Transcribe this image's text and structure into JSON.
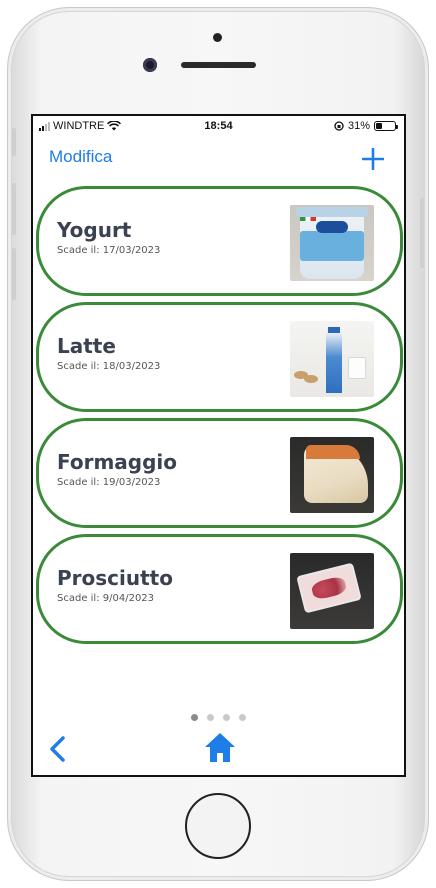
{
  "status_bar": {
    "carrier": "WINDTRE",
    "time": "18:54",
    "battery_percent": "31%",
    "battery_level": 0.31,
    "icons": [
      "signal-icon",
      "wifi-icon",
      "orientation-lock-icon",
      "battery-icon"
    ]
  },
  "nav": {
    "edit_label": "Modifica",
    "add_label": "+"
  },
  "items": [
    {
      "name": "Yogurt",
      "expiry": "Scade il: 17/03/2023",
      "image": "yogurt-thumbnail"
    },
    {
      "name": "Latte",
      "expiry": "Scade il: 18/03/2023",
      "image": "milk-thumbnail"
    },
    {
      "name": "Formaggio",
      "expiry": "Scade il: 19/03/2023",
      "image": "cheese-thumbnail"
    },
    {
      "name": "Prosciutto",
      "expiry": "Scade il: 9/04/2023",
      "image": "ham-thumbnail"
    }
  ],
  "pagination": {
    "pages": 4,
    "current": 1
  },
  "tab_bar": {
    "icons": [
      "chevron-left-icon",
      "home-icon"
    ]
  },
  "colors": {
    "accent": "#1e7de6",
    "card_border": "#3a8a3a",
    "item_title": "#3a4150"
  }
}
